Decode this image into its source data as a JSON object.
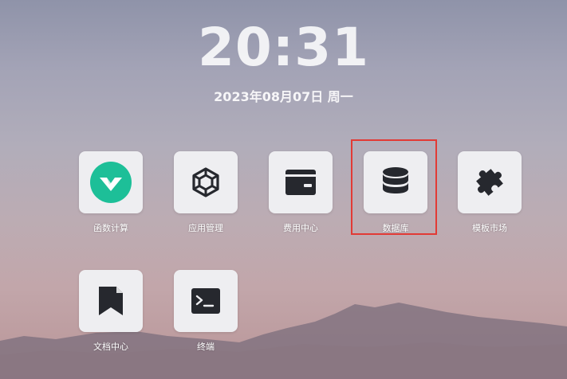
{
  "clock": {
    "time": "20:31"
  },
  "date": {
    "text": "2023年08月07日 周一"
  },
  "apps": [
    {
      "label": "函数计算",
      "icon": "function-compute-icon"
    },
    {
      "label": "应用管理",
      "icon": "hexagon-cube-icon"
    },
    {
      "label": "费用中心",
      "icon": "wallet-icon"
    },
    {
      "label": "数据库",
      "icon": "database-icon"
    },
    {
      "label": "模板市场",
      "icon": "puzzle-icon"
    },
    {
      "label": "文档中心",
      "icon": "bookmark-icon"
    },
    {
      "label": "终端",
      "icon": "terminal-icon"
    }
  ],
  "colors": {
    "accent_teal": "#1dbf98",
    "icon_dark": "#26282e",
    "highlight_red": "#e23a35",
    "tile_bg": "#eeeef1"
  },
  "highlighted_app": "数据库"
}
